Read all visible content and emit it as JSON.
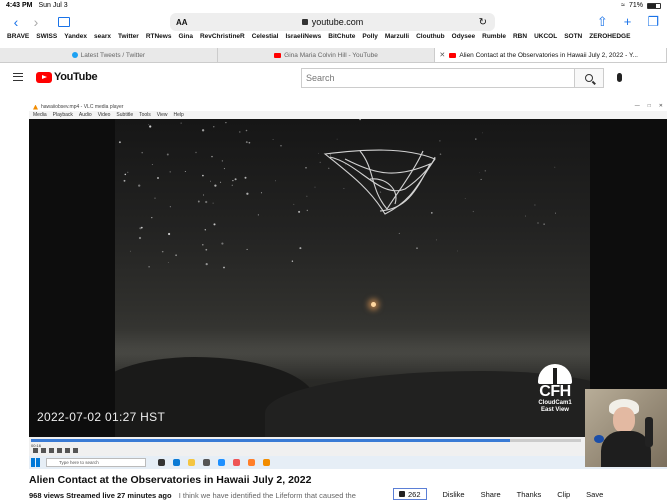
{
  "statusbar": {
    "time": "4:43 PM",
    "date": "Sun Jul 3",
    "battery": "71%"
  },
  "browser": {
    "text_size": "AA",
    "url": "youtube.com"
  },
  "bookmarks": [
    "BRAVE",
    "SWISS",
    "Yandex",
    "searx",
    "Twitter",
    "RTNews",
    "Gina",
    "RevChristineR",
    "Celestial",
    "IsraeliNews",
    "BitChute",
    "Polly",
    "Marzulli",
    "Clouthub",
    "Odysee",
    "Rumble",
    "RBN",
    "UKCOL",
    "SOTN",
    "ZEROHEDGE"
  ],
  "tabs": [
    {
      "label": "Latest Tweets / Twitter"
    },
    {
      "label": "Gina Maria Colvin Hill - YouTube"
    },
    {
      "label": "Alien Contact at the Observatories in Hawaii July 2, 2022 - Y..."
    }
  ],
  "youtube": {
    "logo_text": "YouTube",
    "search_placeholder": "Search"
  },
  "vlc": {
    "window_title": "hawaiiobsev.mp4 - VLC media player",
    "menu": [
      "Media",
      "Playback",
      "Audio",
      "Video",
      "Subtitle",
      "Tools",
      "View",
      "Help"
    ],
    "current_time": "00:16",
    "progress": 0.87,
    "taskbar_search": "Type here to search"
  },
  "video": {
    "timestamp": "2022-07-02 01:27 HST",
    "logo_big": "CFH",
    "logo_line1": "CloudCam1",
    "logo_line2": "East View"
  },
  "page": {
    "title": "Alien Contact at the Observatories in Hawaii July 2, 2022",
    "views": "968 views",
    "streamed": "Streamed live 27 minutes ago",
    "desc": "I think we have identified the Lifeform that caused the"
  },
  "actions": {
    "likes": "262",
    "dislike": "Dislike",
    "share": "Share",
    "thanks": "Thanks",
    "clip": "Clip",
    "save": "Save"
  },
  "colors": {
    "youtube_red": "#ff0000",
    "ios_blue": "#1a73e8",
    "vlc_progress": "#3a7bd5"
  }
}
